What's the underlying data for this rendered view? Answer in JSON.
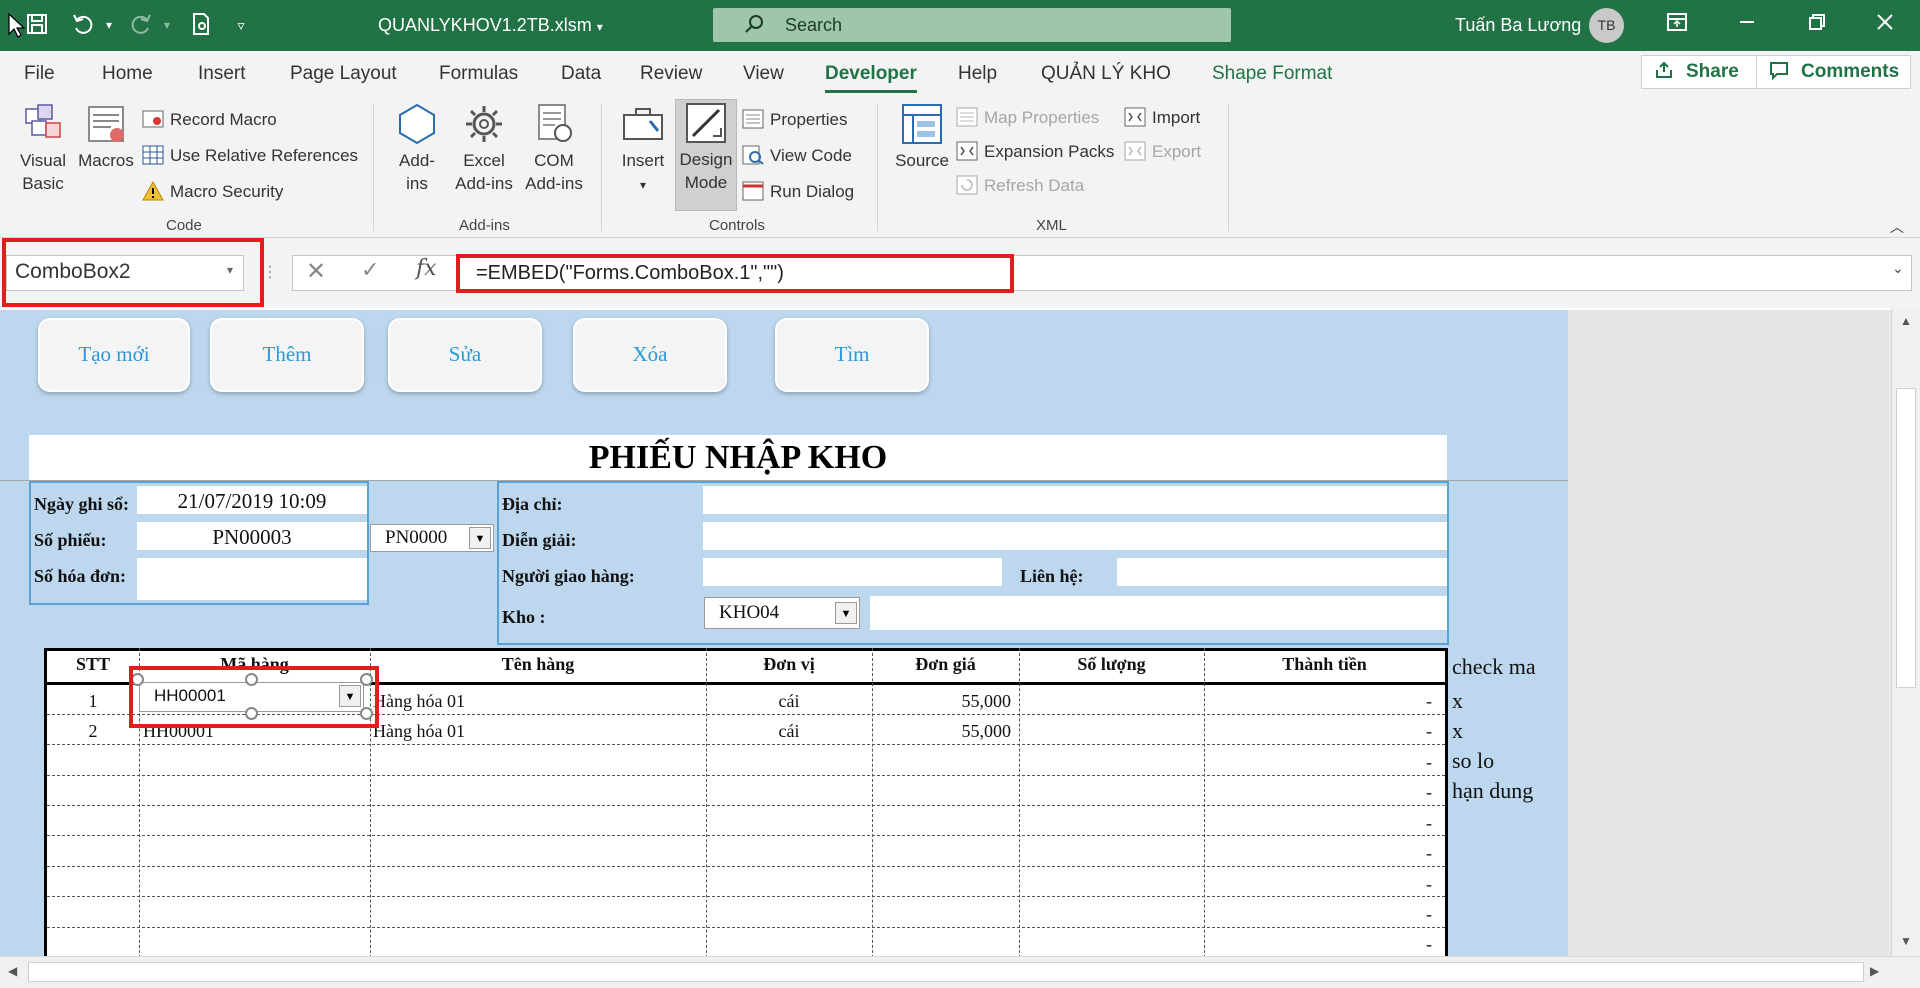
{
  "titlebar": {
    "doc_title": "QUANLYKHOV1.2TB.xlsm",
    "search_label": "Search",
    "user_name": "Tuấn Ba Lương",
    "user_initials": "TB"
  },
  "tabs": [
    "File",
    "Home",
    "Insert",
    "Page Layout",
    "Formulas",
    "Data",
    "Review",
    "View",
    "Developer",
    "Help",
    "QUẢN LÝ KHO",
    "Shape Format"
  ],
  "active_tab": "Developer",
  "share_label": "Share",
  "comments_label": "Comments",
  "ribbon": {
    "code": {
      "visual_basic": "Visual Basic",
      "visual": "Visual",
      "basic": "Basic",
      "macros": "Macros",
      "record_macro": "Record Macro",
      "use_relative": "Use Relative References",
      "macro_security": "Macro Security",
      "label": "Code"
    },
    "addins": {
      "add": "Add-",
      "ins": "ins",
      "excel": "Excel",
      "excel2": "Add-ins",
      "com": "COM",
      "com2": "Add-ins",
      "label": "Add-ins"
    },
    "controls": {
      "insert": "Insert",
      "design": "Design",
      "mode": "Mode",
      "properties": "Properties",
      "view_code": "View Code",
      "run_dialog": "Run Dialog",
      "label": "Controls"
    },
    "xml": {
      "source": "Source",
      "map_properties": "Map Properties",
      "expansion_packs": "Expansion Packs",
      "refresh_data": "Refresh Data",
      "import": "Import",
      "export": "Export",
      "label": "XML"
    }
  },
  "formula_bar": {
    "name_box": "ComboBox2",
    "formula": "=EMBED(\"Forms.ComboBox.1\",\"\")",
    "fx": "fx"
  },
  "form_buttons": [
    "Tạo mới",
    "Thêm",
    "Sửa",
    "Xóa",
    "Tìm"
  ],
  "form": {
    "title": "PHIẾU NHẬP KHO",
    "ngay_label": "Ngày ghi sổ:",
    "ngay_value": "21/07/2019 10:09",
    "sophieu_label": "Số phiếu:",
    "sophieu_value": "PN00003",
    "sophieu_combo": "PN0000",
    "sohd_label": "Số hóa đơn:",
    "diachi_label": "Địa chỉ:",
    "diengiai_label": "Diễn giải:",
    "nguoigiao_label": "Người giao hàng:",
    "lienhe_label": "Liên hệ:",
    "kho_label": "Kho :",
    "kho_value": "KHO04"
  },
  "table": {
    "headers": [
      "STT",
      "Mã hàng",
      "Tên hàng",
      "Đơn vị",
      "Đơn giá",
      "Số lượng",
      "Thành tiền"
    ],
    "rows": [
      {
        "stt": "1",
        "ma": "HH00001",
        "ten": "Hàng hóa 01",
        "dv": "cái",
        "gia": "55,000",
        "tien": "-"
      },
      {
        "stt": "2",
        "ma": "HH00001",
        "ten": "Hàng hóa 01",
        "dv": "cái",
        "gia": "55,000",
        "tien": "-"
      }
    ],
    "dash": "-",
    "row_combo": "HH00001"
  },
  "side_notes": [
    "check ma",
    "x",
    "x",
    "so lo",
    "hạn dung"
  ],
  "colors": {
    "excel_green": "#217346",
    "sheet_blue": "#bcd7ee",
    "button_text": "#2a9ad8",
    "highlight_red": "#e01e1e"
  }
}
